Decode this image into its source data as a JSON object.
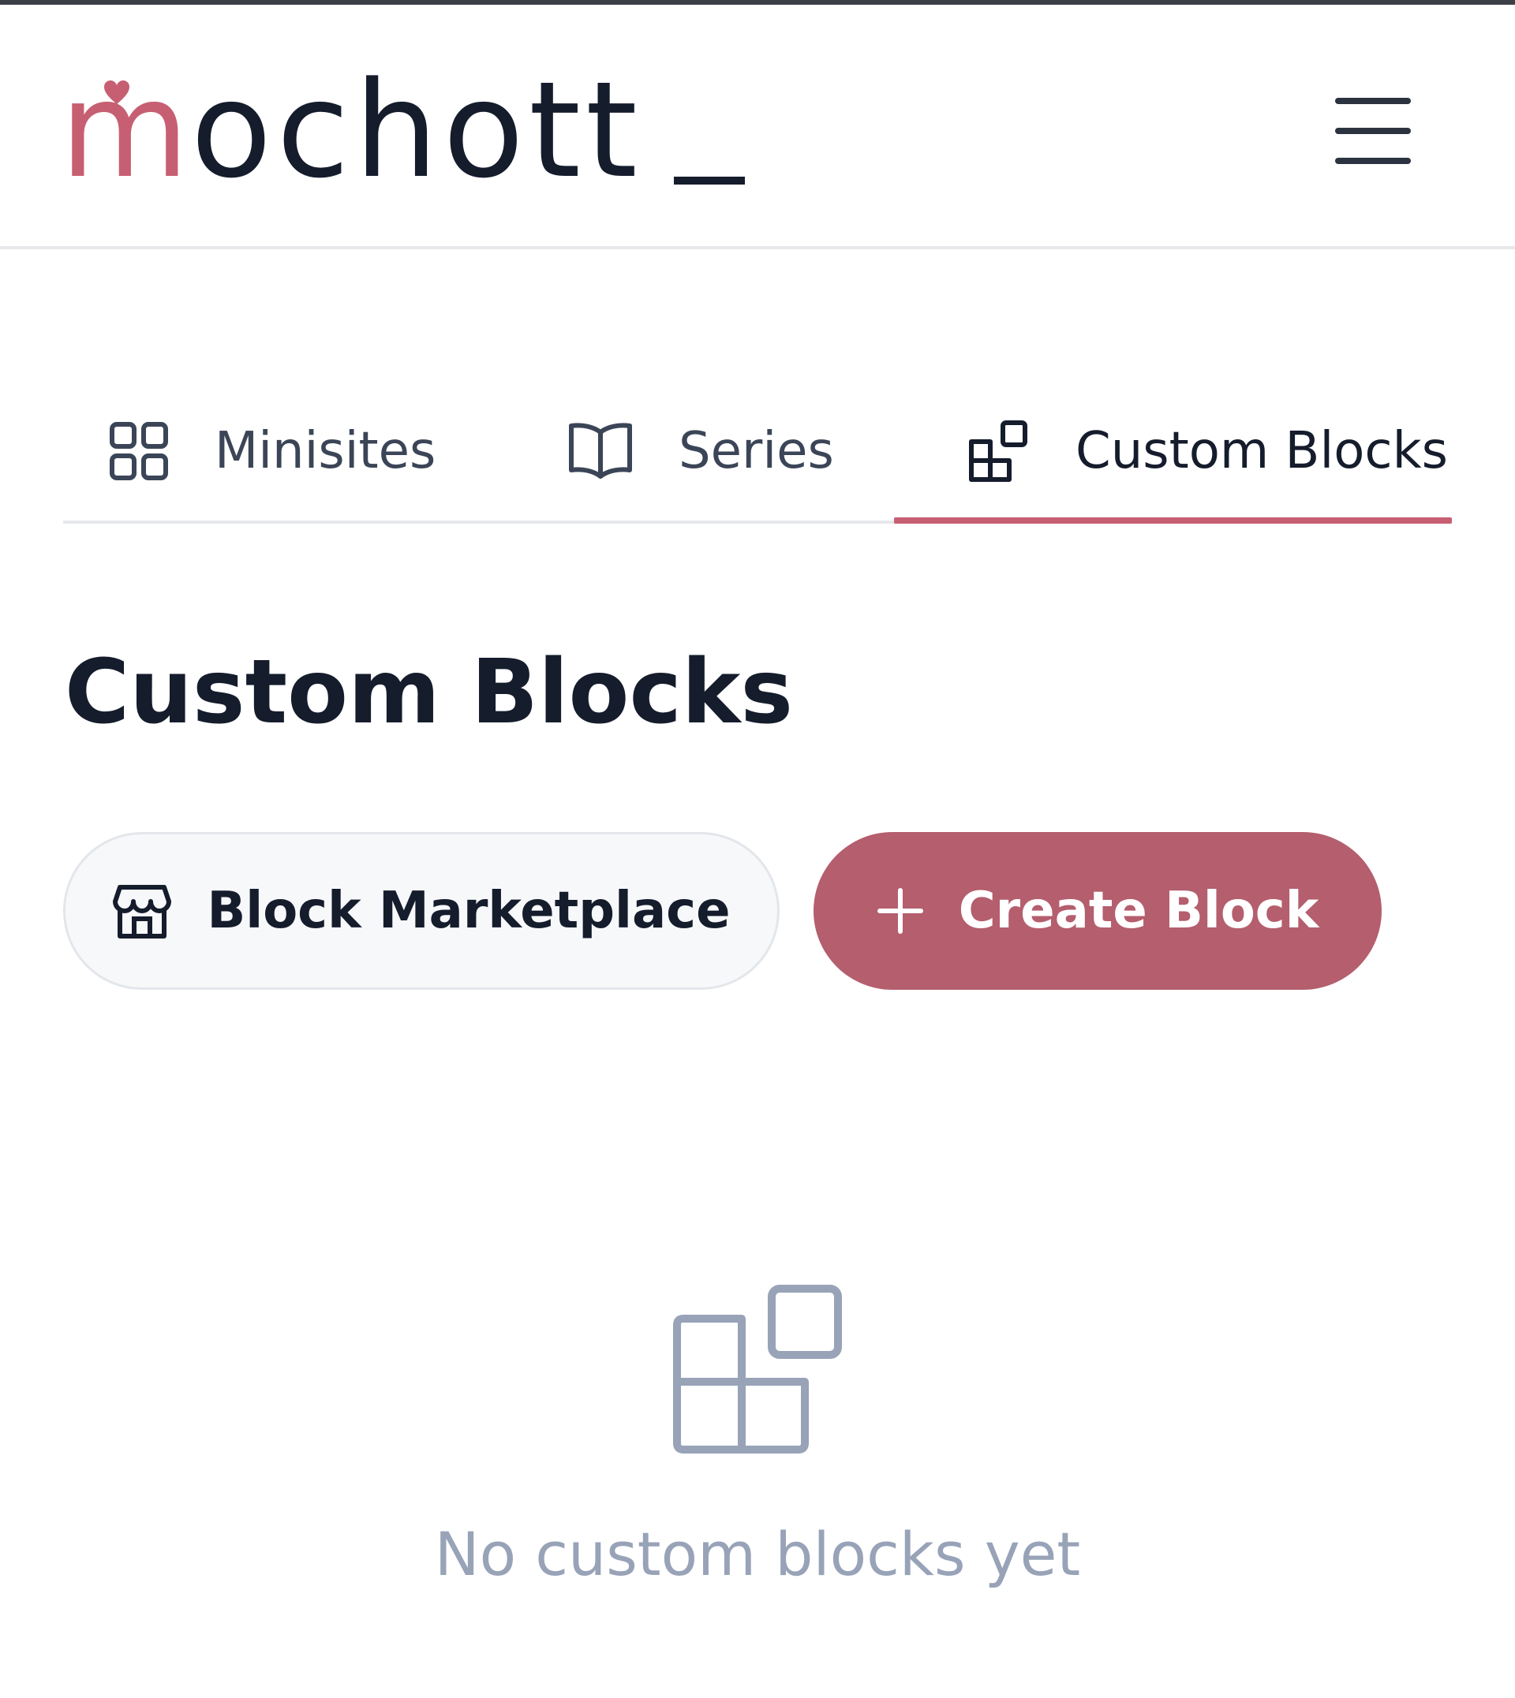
{
  "app": {
    "logo_text_accent": "m",
    "logo_text": "ochott",
    "brand_color": "#c75f72"
  },
  "header": {
    "menu_icon": "hamburger-menu-icon"
  },
  "tabs": [
    {
      "label": "Minisites",
      "icon": "grid-icon",
      "active": false
    },
    {
      "label": "Series",
      "icon": "book-open-icon",
      "active": false
    },
    {
      "label": "Custom Blocks",
      "icon": "blocks-icon",
      "active": true
    }
  ],
  "main": {
    "title": "Custom Blocks",
    "marketplace_button": {
      "label": "Block Marketplace",
      "icon": "store-icon"
    },
    "create_button": {
      "label": "Create Block",
      "icon": "plus-icon",
      "color": "#b45e6e"
    },
    "empty_state": {
      "icon": "blocks-icon",
      "text": "No custom blocks yet"
    }
  }
}
